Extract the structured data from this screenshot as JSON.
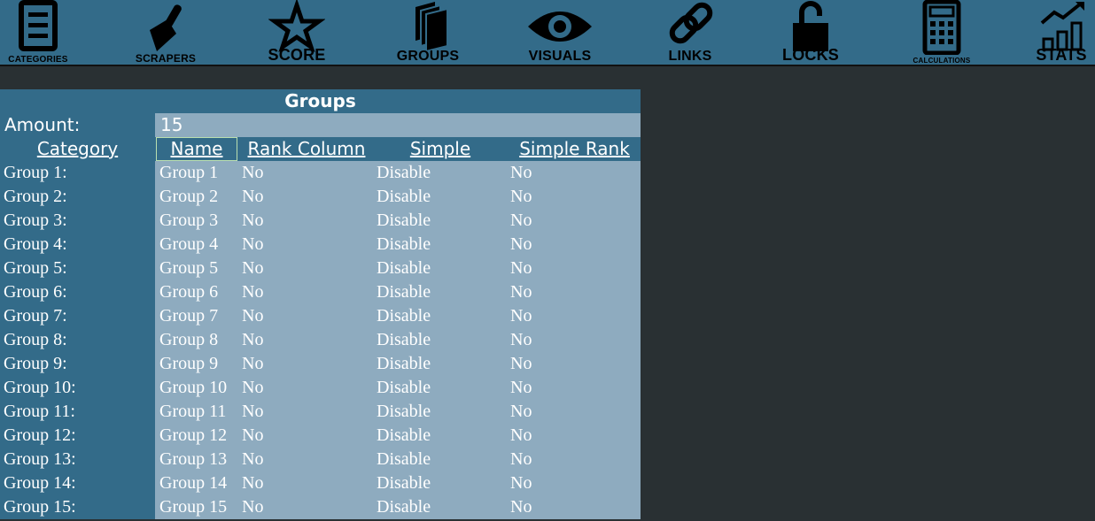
{
  "toolbar": {
    "items": [
      {
        "label": "CATEGORIES",
        "icon": "categories-icon"
      },
      {
        "label": "SCRAPERS",
        "icon": "scraper-icon"
      },
      {
        "label": "SCORE",
        "icon": "star-icon"
      },
      {
        "label": "GROUPS",
        "icon": "groups-icon"
      },
      {
        "label": "VISUALS",
        "icon": "eye-icon"
      },
      {
        "label": "LINKS",
        "icon": "link-icon"
      },
      {
        "label": "LOCKS",
        "icon": "lock-icon"
      },
      {
        "label": "CALCULATIONS",
        "icon": "calculator-icon"
      },
      {
        "label": "STATS",
        "icon": "stats-icon"
      }
    ]
  },
  "colors": {
    "toolbar_bg": "#336b89",
    "panel_bg": "#336b89",
    "cell_bg": "#8eabbf",
    "page_bg": "#293033"
  },
  "panel": {
    "title": "Groups",
    "amount_label": "Amount:",
    "amount_value": "15",
    "headers": {
      "category": "Category",
      "name": "Name",
      "rank_column": "Rank Column",
      "simple": "Simple",
      "simple_rank": "Simple Rank"
    },
    "rows": [
      {
        "category": "Group 1:",
        "name": "Group 1",
        "rank_column": "No",
        "simple": "Disable",
        "simple_rank": "No"
      },
      {
        "category": "Group 2:",
        "name": "Group 2",
        "rank_column": "No",
        "simple": "Disable",
        "simple_rank": "No"
      },
      {
        "category": "Group 3:",
        "name": "Group 3",
        "rank_column": "No",
        "simple": "Disable",
        "simple_rank": "No"
      },
      {
        "category": "Group 4:",
        "name": "Group 4",
        "rank_column": "No",
        "simple": "Disable",
        "simple_rank": "No"
      },
      {
        "category": "Group 5:",
        "name": "Group 5",
        "rank_column": "No",
        "simple": "Disable",
        "simple_rank": "No"
      },
      {
        "category": "Group 6:",
        "name": "Group 6",
        "rank_column": "No",
        "simple": "Disable",
        "simple_rank": "No"
      },
      {
        "category": "Group 7:",
        "name": "Group 7",
        "rank_column": "No",
        "simple": "Disable",
        "simple_rank": "No"
      },
      {
        "category": "Group 8:",
        "name": "Group 8",
        "rank_column": "No",
        "simple": "Disable",
        "simple_rank": "No"
      },
      {
        "category": "Group 9:",
        "name": "Group 9",
        "rank_column": "No",
        "simple": "Disable",
        "simple_rank": "No"
      },
      {
        "category": "Group 10:",
        "name": "Group 10",
        "rank_column": "No",
        "simple": "Disable",
        "simple_rank": "No"
      },
      {
        "category": "Group 11:",
        "name": "Group 11",
        "rank_column": "No",
        "simple": "Disable",
        "simple_rank": "No"
      },
      {
        "category": "Group 12:",
        "name": "Group 12",
        "rank_column": "No",
        "simple": "Disable",
        "simple_rank": "No"
      },
      {
        "category": "Group 13:",
        "name": "Group 13",
        "rank_column": "No",
        "simple": "Disable",
        "simple_rank": "No"
      },
      {
        "category": "Group 14:",
        "name": "Group 14",
        "rank_column": "No",
        "simple": "Disable",
        "simple_rank": "No"
      },
      {
        "category": "Group 15:",
        "name": "Group 15",
        "rank_column": "No",
        "simple": "Disable",
        "simple_rank": "No"
      }
    ]
  }
}
